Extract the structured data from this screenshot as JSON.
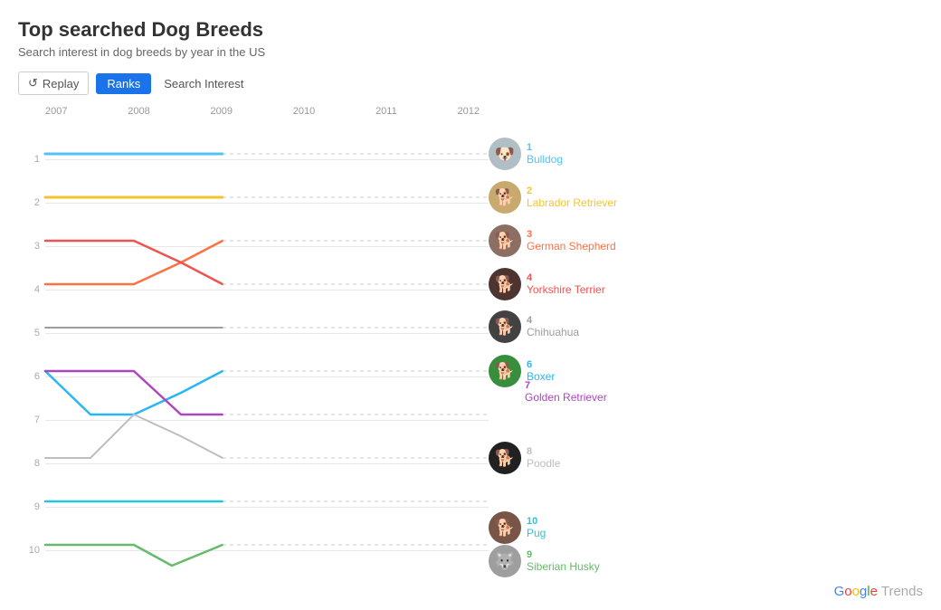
{
  "page": {
    "title": "Top searched Dog Breeds",
    "subtitle": "Search interest in dog breeds by year in the US"
  },
  "toolbar": {
    "replay_label": "Replay",
    "ranks_label": "Ranks",
    "search_interest_label": "Search Interest"
  },
  "years": [
    "2007",
    "2008",
    "2009",
    "2010",
    "2011",
    "2012"
  ],
  "ranks": [
    1,
    2,
    3,
    4,
    5,
    6,
    7,
    8,
    9,
    10
  ],
  "dogs": [
    {
      "rank": 1,
      "name": "Bulldog",
      "color": "#4fc3f7",
      "avatar": "🐕",
      "bg": "#b0bec5"
    },
    {
      "rank": 2,
      "name": "Labrador Retriever",
      "color": "#f4c430",
      "avatar": "🐕",
      "bg": "#c8a96e"
    },
    {
      "rank": 3,
      "name": "German Shepherd",
      "color": "#ff7043",
      "avatar": "🐕",
      "bg": "#a0522d"
    },
    {
      "rank": 4,
      "name": "Yorkshire Terrier",
      "color": "#ef5350",
      "avatar": "🐕",
      "bg": "#5c4033"
    },
    {
      "rank": "4",
      "name": "Chihuahua",
      "color": "#9e9e9e",
      "avatar": "🐕",
      "bg": "#616161"
    },
    {
      "rank": 6,
      "name": "Boxer",
      "color": "#29b6f6",
      "avatar": "🐕",
      "bg": "#4caf50"
    },
    {
      "rank": 7,
      "name": "Golden Retriever",
      "color": "#ab47bc",
      "avatar": "🐕",
      "bg": "#8d6e63"
    },
    {
      "rank": 8,
      "name": "Poodle",
      "color": "#bdbdbd",
      "avatar": "🐕",
      "bg": "#212121"
    },
    {
      "rank": 10,
      "name": "Pug",
      "color": "#26c6da",
      "avatar": "🐕",
      "bg": "#795548"
    },
    {
      "rank": 9,
      "name": "Siberian Husky",
      "color": "#66bb6a",
      "avatar": "🐕",
      "bg": "#9e9e9e"
    }
  ],
  "google_trends": "Google Trends"
}
